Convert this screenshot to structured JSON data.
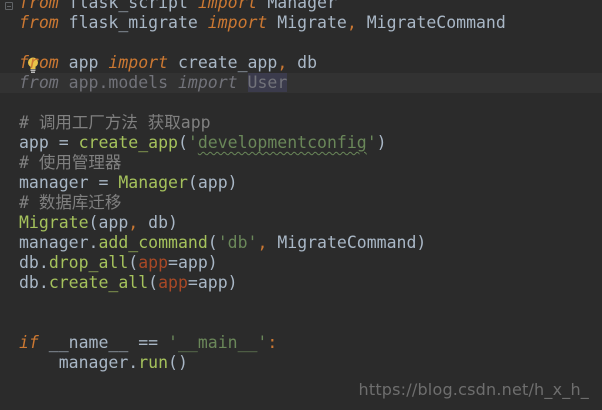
{
  "editor": {
    "code": {
      "line0": {
        "t1": "from",
        "t2": " flask_script ",
        "t3": "import",
        "t4": " Manager"
      },
      "line1": {
        "t1": "from",
        "t2": " flask_migrate ",
        "t3": "import",
        "t4": " Migrate",
        "t5": ",",
        "t6": " MigrateCommand"
      },
      "line3": {
        "t1": "from",
        "t2": " app ",
        "t3": "import",
        "t4": " create_app",
        "t5": ",",
        "t6": " db"
      },
      "line4": {
        "t1": "from",
        "t2": " app.models ",
        "t3": "import",
        "t4": " ",
        "t5": "User"
      },
      "line6": {
        "t1": "# 调用工厂方法 获取app"
      },
      "line7": {
        "t1": "app = ",
        "t2": "create_app",
        "t3": "(",
        "t4": "'",
        "t5": "developmentconfig",
        "t6": "'",
        "t7": ")"
      },
      "line8": {
        "t1": "# 使用管理器"
      },
      "line9": {
        "t1": "manager = ",
        "t2": "Manager",
        "t3": "(app)"
      },
      "line10": {
        "t1": "# 数据库迁移"
      },
      "line11": {
        "t1": "Migrate",
        "t2": "(app",
        "t3": ",",
        "t4": " db)"
      },
      "line12": {
        "t1": "manager.",
        "t2": "add_command",
        "t3": "(",
        "t4": "'db'",
        "t5": ",",
        "t6": " MigrateCommand)"
      },
      "line13": {
        "t1": "db.",
        "t2": "drop_all",
        "t3": "(",
        "t4": "app",
        "t5": "=app)"
      },
      "line14": {
        "t1": "db.",
        "t2": "create_all",
        "t3": "(",
        "t4": "app",
        "t5": "=app)"
      },
      "line17": {
        "t1": "if",
        "t2": " __name__ ",
        "t3": "==",
        "t4": " ",
        "t5": "'__main__'",
        "t6": ":"
      },
      "line18": {
        "t1": "    manager.",
        "t2": "run",
        "t3": "()"
      }
    },
    "watermark": "https://blog.csdn.net/h_x_h_"
  },
  "colors": {
    "background": "#2b2b2b",
    "keyword": "#cc7832",
    "string": "#6a8759",
    "comment": "#808080",
    "function": "#a5c25c",
    "parameter": "#aa4926",
    "text": "#a9b7c6"
  },
  "icons": {
    "gutter_bulb": "lightbulb-icon",
    "fold": "fold-marker-icon"
  }
}
